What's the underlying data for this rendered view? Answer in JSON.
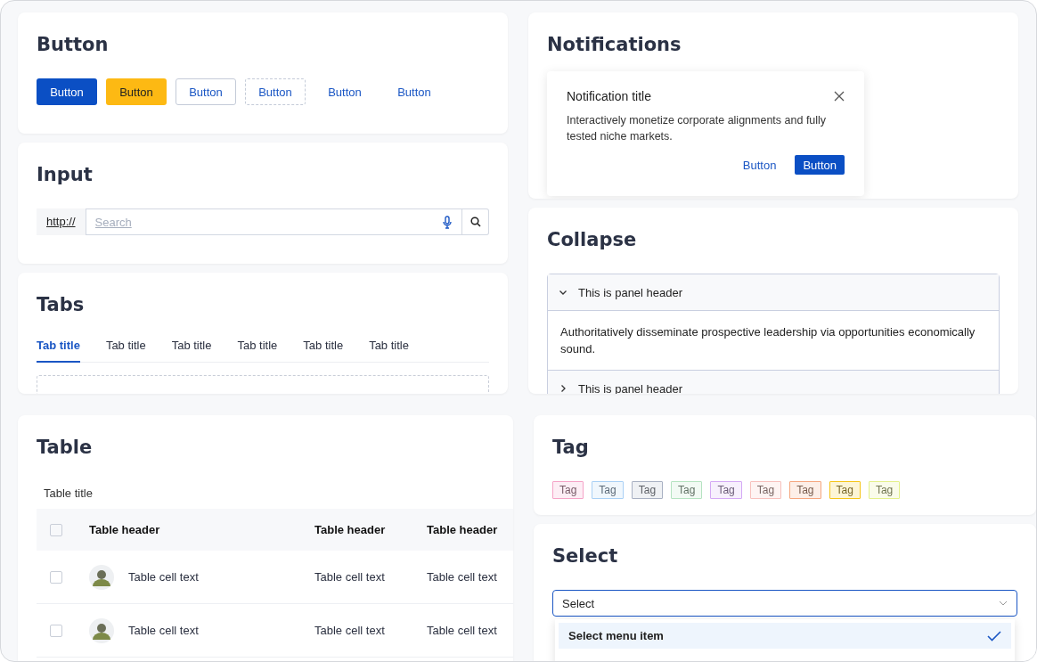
{
  "button_card": {
    "title": "Button",
    "buttons": [
      {
        "label": "Button",
        "kind": "primary"
      },
      {
        "label": "Button",
        "kind": "warning"
      },
      {
        "label": "Button",
        "kind": "outline"
      },
      {
        "label": "Button",
        "kind": "dashed"
      },
      {
        "label": "Button",
        "kind": "text"
      },
      {
        "label": "Button",
        "kind": "text"
      }
    ]
  },
  "input_card": {
    "title": "Input",
    "addon": "http://",
    "placeholder": "Search"
  },
  "tabs_card": {
    "title": "Tabs",
    "tabs": [
      {
        "label": "Tab title",
        "selected": true
      },
      {
        "label": "Tab title",
        "selected": false
      },
      {
        "label": "Tab title",
        "selected": false
      },
      {
        "label": "Tab title",
        "selected": false
      },
      {
        "label": "Tab title",
        "selected": false
      },
      {
        "label": "Tab title",
        "selected": false
      }
    ]
  },
  "notifications_card": {
    "title": "Notifications",
    "notification": {
      "title": "Notification title",
      "message": "Interactively monetize corporate alignments and fully tested niche markets.",
      "buttons": [
        {
          "label": "Button",
          "kind": "text"
        },
        {
          "label": "Button",
          "kind": "primary"
        }
      ]
    }
  },
  "collapse_card": {
    "title": "Collapse",
    "panels": [
      {
        "header": "This is panel header",
        "expanded": true,
        "body": "Authoritatively disseminate prospective leadership via opportunities economically sound."
      },
      {
        "header": "This is panel header",
        "expanded": false
      }
    ]
  },
  "table_card": {
    "title": "Table",
    "table_title": "Table title",
    "columns": [
      "Table header",
      "Table header",
      "Table header"
    ],
    "header_checked": false,
    "rows": [
      {
        "checked": false,
        "cells": [
          "Table cell text",
          "Table cell text",
          "Table cell text"
        ]
      },
      {
        "checked": false,
        "cells": [
          "Table cell text",
          "Table cell text",
          "Table cell text"
        ]
      }
    ]
  },
  "tag_card": {
    "title": "Tag",
    "tags": [
      {
        "label": "Tag",
        "color": "#f5a3c7"
      },
      {
        "label": "Tag",
        "color": "#a9d0f5"
      },
      {
        "label": "Tag",
        "color": "#a8b0c2"
      },
      {
        "label": "Tag",
        "color": "#b5e3c1"
      },
      {
        "label": "Tag",
        "color": "#d4a9f5"
      },
      {
        "label": "Tag",
        "color": "#f7c1bd"
      },
      {
        "label": "Tag",
        "color": "#f5a77f"
      },
      {
        "label": "Tag",
        "color": "#f5c518"
      },
      {
        "label": "Tag",
        "color": "#e4f08a"
      }
    ]
  },
  "select_card": {
    "title": "Select",
    "value": "Select",
    "menu": [
      {
        "label": "Select menu item",
        "selected": true
      }
    ]
  }
}
